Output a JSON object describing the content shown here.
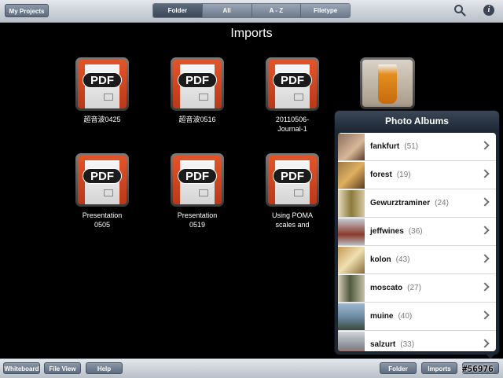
{
  "toolbar": {
    "my_projects": "My Projects",
    "segments": [
      "Folder",
      "All",
      "A - Z",
      "Filetype"
    ],
    "active_segment": "Folder"
  },
  "main": {
    "title": "Imports",
    "files": [
      {
        "name": "超音波0425",
        "type": "pdf"
      },
      {
        "name": "超音波0516",
        "type": "pdf"
      },
      {
        "name": "20110506-Journal-1",
        "type": "pdf"
      },
      {
        "name": "",
        "type": "photo"
      },
      {
        "name": "Presentation 0505",
        "type": "pdf"
      },
      {
        "name": "Presentation 0519",
        "type": "pdf"
      },
      {
        "name": "Using POMA scales and",
        "type": "pdf"
      }
    ],
    "pdf_badge": "PDF"
  },
  "popover": {
    "title": "Photo Albums",
    "albums": [
      {
        "name": "fankfurt",
        "count": "(51)",
        "color": "#8a6e5e"
      },
      {
        "name": "forest",
        "count": "(19)",
        "color": "#9a7a4a"
      },
      {
        "name": "Gewurztraminer",
        "count": "(24)",
        "color": "#c8b48a"
      },
      {
        "name": "jeffwines",
        "count": "(36)",
        "color": "#b8bcc4"
      },
      {
        "name": "kolon",
        "count": "(43)",
        "color": "#c29a5a"
      },
      {
        "name": "moscato",
        "count": "(27)",
        "color": "#4e5a3e"
      },
      {
        "name": "muine",
        "count": "(40)",
        "color": "#6d8aa4"
      },
      {
        "name": "salzurt",
        "count": "(33)",
        "color": "#8a8f96"
      }
    ]
  },
  "bottombar": {
    "whiteboard": "Whiteboard",
    "file_view": "File View",
    "help": "Help",
    "folder": "Folder",
    "imports": "Imports"
  },
  "watermark": "#56976"
}
